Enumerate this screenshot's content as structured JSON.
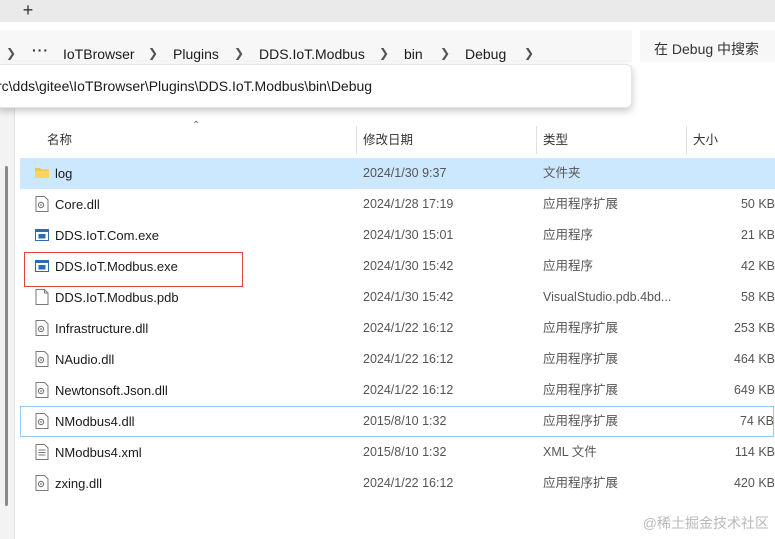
{
  "tabbar": {
    "new_tab": "+"
  },
  "breadcrumb": {
    "items": [
      "IoTBrowser",
      "Plugins",
      "DDS.IoT.Modbus",
      "bin",
      "Debug"
    ]
  },
  "search": {
    "placeholder": "在 Debug 中搜索"
  },
  "address_popup": {
    "path": "rc\\dds\\gitee\\IoTBrowser\\Plugins\\DDS.IoT.Modbus\\bin\\Debug"
  },
  "columns": {
    "name": "名称",
    "date": "修改日期",
    "type": "类型",
    "size": "大小"
  },
  "files": [
    {
      "name": "log",
      "date": "2024/1/30 9:37",
      "type": "文件夹",
      "size": "",
      "icon": "folder-icon"
    },
    {
      "name": "Core.dll",
      "date": "2024/1/28 17:19",
      "type": "应用程序扩展",
      "size": "50 KB",
      "icon": "dll-file-icon"
    },
    {
      "name": "DDS.IoT.Com.exe",
      "date": "2024/1/30 15:01",
      "type": "应用程序",
      "size": "21 KB",
      "icon": "exe-file-icon"
    },
    {
      "name": "DDS.IoT.Modbus.exe",
      "date": "2024/1/30 15:42",
      "type": "应用程序",
      "size": "42 KB",
      "icon": "exe-file-icon"
    },
    {
      "name": "DDS.IoT.Modbus.pdb",
      "date": "2024/1/30 15:42",
      "type": "VisualStudio.pdb.4bd...",
      "size": "58 KB",
      "icon": "blank-file-icon"
    },
    {
      "name": "Infrastructure.dll",
      "date": "2024/1/22 16:12",
      "type": "应用程序扩展",
      "size": "253 KB",
      "icon": "dll-file-icon"
    },
    {
      "name": "NAudio.dll",
      "date": "2024/1/22 16:12",
      "type": "应用程序扩展",
      "size": "464 KB",
      "icon": "dll-file-icon"
    },
    {
      "name": "Newtonsoft.Json.dll",
      "date": "2024/1/22 16:12",
      "type": "应用程序扩展",
      "size": "649 KB",
      "icon": "dll-file-icon"
    },
    {
      "name": "NModbus4.dll",
      "date": "2015/8/10 1:32",
      "type": "应用程序扩展",
      "size": "74 KB",
      "icon": "dll-file-icon"
    },
    {
      "name": "NModbus4.xml",
      "date": "2015/8/10 1:32",
      "type": "XML 文件",
      "size": "114 KB",
      "icon": "xml-file-icon"
    },
    {
      "name": "zxing.dll",
      "date": "2024/1/22 16:12",
      "type": "应用程序扩展",
      "size": "420 KB",
      "icon": "dll-file-icon"
    }
  ],
  "watermark": "@稀土掘金技术社区"
}
